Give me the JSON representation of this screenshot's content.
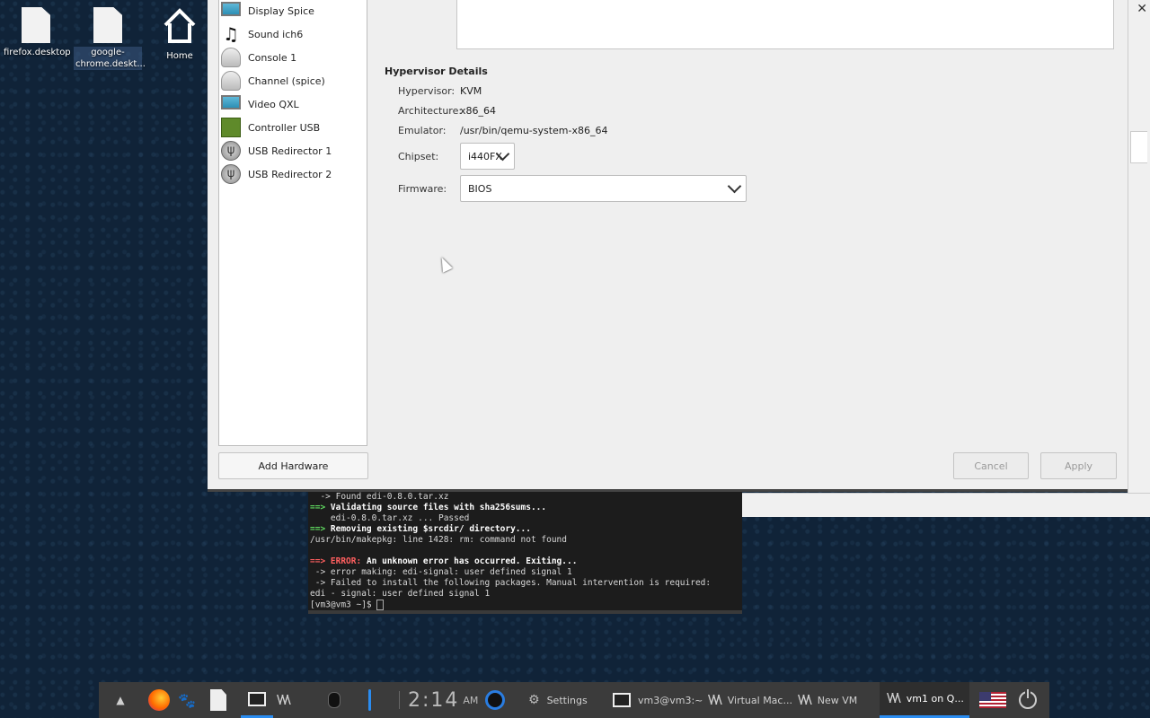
{
  "desktop": {
    "icons": [
      {
        "label": "firefox.desktop",
        "name": "firefox-desktop-file"
      },
      {
        "label": "google-\nchrome.deskt...",
        "name": "chrome-desktop-file"
      },
      {
        "label": "Home",
        "name": "home-folder"
      }
    ]
  },
  "dialog": {
    "hardware_list": [
      {
        "label": "Display Spice",
        "icon": "monitor-icon"
      },
      {
        "label": "Sound ich6",
        "icon": "sound-icon"
      },
      {
        "label": "Console 1",
        "icon": "console-icon"
      },
      {
        "label": "Channel (spice)",
        "icon": "channel-icon"
      },
      {
        "label": "Video QXL",
        "icon": "video-icon"
      },
      {
        "label": "Controller USB",
        "icon": "controller-icon"
      },
      {
        "label": "USB Redirector 1",
        "icon": "usb-icon"
      },
      {
        "label": "USB Redirector 2",
        "icon": "usb-icon"
      }
    ],
    "add_hardware_label": "Add Hardware",
    "hypervisor": {
      "section_title": "Hypervisor Details",
      "hypervisor_label": "Hypervisor:",
      "hypervisor_value": "KVM",
      "arch_label": "Architecture:",
      "arch_value": "x86_64",
      "emulator_label": "Emulator:",
      "emulator_value": "/usr/bin/qemu-system-x86_64",
      "chipset_label": "Chipset:",
      "chipset_value": "i440FX",
      "firmware_label": "Firmware:",
      "firmware_value": "BIOS"
    },
    "cancel_label": "Cancel",
    "apply_label": "Apply"
  },
  "terminal": {
    "lines": [
      {
        "parts": [
          {
            "t": "  -> Found edi-0.8.0.tar.xz",
            "c": ""
          }
        ]
      },
      {
        "parts": [
          {
            "t": "==> ",
            "c": "g"
          },
          {
            "t": "Validating source files with sha256sums...",
            "c": "b"
          }
        ]
      },
      {
        "parts": [
          {
            "t": "    edi-0.8.0.tar.xz ... Passed",
            "c": ""
          }
        ]
      },
      {
        "parts": [
          {
            "t": "==> ",
            "c": "g"
          },
          {
            "t": "Removing existing $srcdir/ directory...",
            "c": "b"
          }
        ]
      },
      {
        "parts": [
          {
            "t": "/usr/bin/makepkg: line 1428: rm: command not found",
            "c": ""
          }
        ]
      },
      {
        "parts": [
          {
            "t": "",
            "c": ""
          }
        ]
      },
      {
        "parts": [
          {
            "t": "==> ",
            "c": "r"
          },
          {
            "t": "ERROR: ",
            "c": "r"
          },
          {
            "t": "An unknown error has occurred. Exiting...",
            "c": "b"
          }
        ]
      },
      {
        "parts": [
          {
            "t": " -> error making: edi-signal: user defined signal 1",
            "c": ""
          }
        ]
      },
      {
        "parts": [
          {
            "t": " -> Failed to install the following packages. Manual intervention is required:",
            "c": ""
          }
        ]
      },
      {
        "parts": [
          {
            "t": "edi - signal: user defined signal 1",
            "c": ""
          }
        ]
      },
      {
        "parts": [
          {
            "t": "[vm3@vm3 ~]$ ",
            "c": ""
          }
        ]
      }
    ]
  },
  "taskbar": {
    "clock": "2:14",
    "ampm": "AM",
    "settings_label": "Settings",
    "tasks": [
      {
        "label": "vm3@vm3:~",
        "name": "task-terminal"
      },
      {
        "label": "Virtual Mac...",
        "name": "task-virt-manager"
      },
      {
        "label": "New VM",
        "name": "task-new-vm"
      },
      {
        "label": "vm1 on Q...",
        "name": "task-vm1"
      }
    ],
    "accent_color": "#2a8cf0"
  }
}
